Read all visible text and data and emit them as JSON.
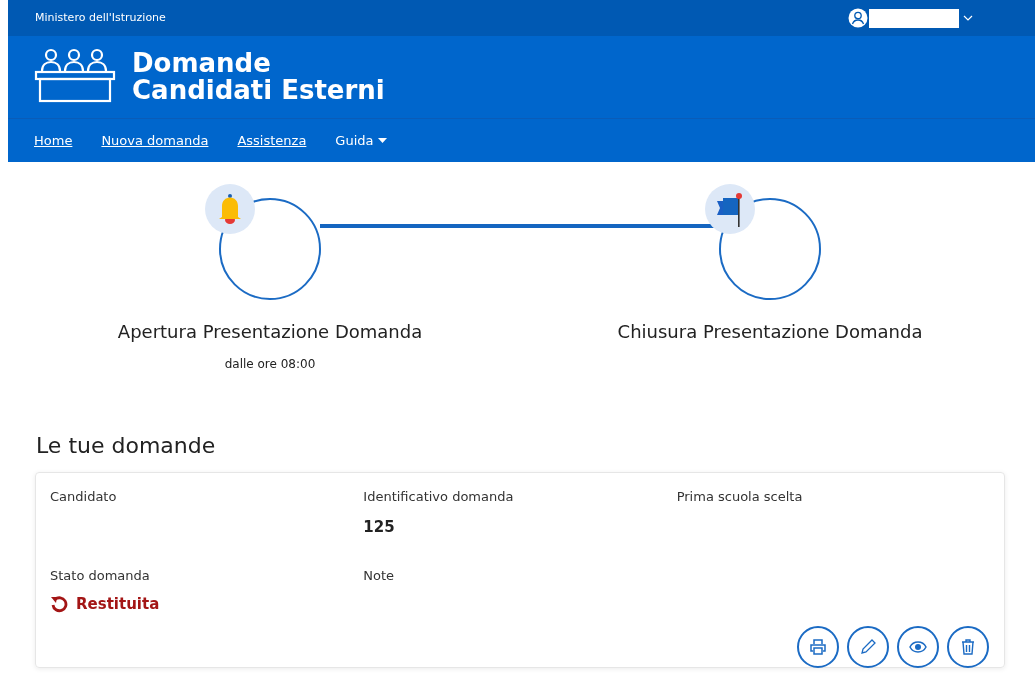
{
  "top_bar": {
    "ministry": "Ministero dell'Istruzione"
  },
  "header": {
    "title_line_1": "Domande",
    "title_line_2": "Candidati Esterni"
  },
  "nav": [
    {
      "label": "Home",
      "kind": "link"
    },
    {
      "label": "Nuova domanda",
      "kind": "link"
    },
    {
      "label": "Assistenza",
      "kind": "link"
    },
    {
      "label": "Guida",
      "kind": "dropdown"
    }
  ],
  "steps": [
    {
      "kind": "bell",
      "title": "Apertura Presentazione Domanda",
      "subtitle": "dalle ore 08:00"
    },
    {
      "kind": "flag",
      "title": "Chiusura Presentazione Domanda"
    }
  ],
  "section_title": "Le tue domande",
  "application": {
    "fields": [
      {
        "label": "Candidato"
      },
      {
        "label": "Identificativo domanda",
        "value": "125"
      },
      {
        "label": "Prima scuola scelta"
      },
      {
        "label": "Stato domanda",
        "status": "Restituita",
        "kind": "returned"
      },
      {
        "label": "Note"
      }
    ],
    "actions": [
      {
        "kind": "print"
      },
      {
        "kind": "edit"
      },
      {
        "kind": "view"
      },
      {
        "kind": "delete"
      }
    ]
  }
}
